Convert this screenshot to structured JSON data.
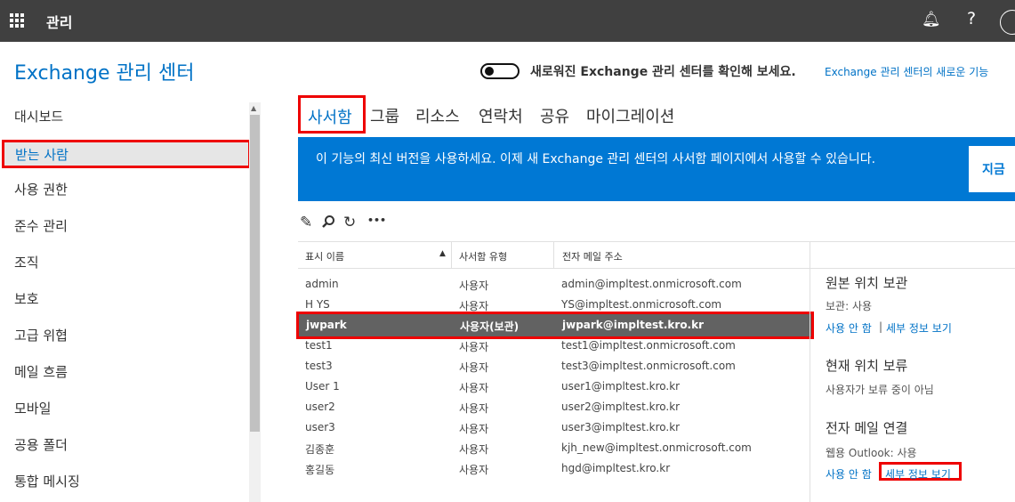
{
  "topbar": {
    "title": "관리"
  },
  "brand": "Exchange 관리 센터",
  "toggle": {
    "label": "새로워진 Exchange 관리 센터를 확인해 보세요.",
    "link": "Exchange 관리 센터의 새로운 기능"
  },
  "sidebar": {
    "items": [
      "대시보드",
      "받는 사람",
      "사용 권한",
      "준수 관리",
      "조직",
      "보호",
      "고급 위협",
      "메일 흐름",
      "모바일",
      "공용 폴더",
      "통합 메시징"
    ],
    "selected": 1
  },
  "tabs": [
    "사서함",
    "그룹",
    "리소스",
    "연락처",
    "공유",
    "마이그레이션"
  ],
  "banner": {
    "text": "이 기능의 최신 버전을 사용하세요. 이제 새 Exchange 관리 센터의 사서함 페이지에서 사용할 수 있습니다.",
    "button": "지금"
  },
  "toolbar": {
    "edit_icon": "pencil-icon",
    "search_icon": "search-icon",
    "refresh_icon": "refresh-icon",
    "more": "•••"
  },
  "table": {
    "columns": [
      "표시 이름",
      "사서함 유형",
      "전자 메일 주소"
    ],
    "rows": [
      {
        "name": "admin",
        "type": "사용자",
        "email": "admin@impltest.onmicrosoft.com"
      },
      {
        "name": "H YS",
        "type": "사용자",
        "email": "YS@impltest.onmicrosoft.com"
      },
      {
        "name": "jwpark",
        "type": "사용자(보관)",
        "email": "jwpark@impltest.kro.kr"
      },
      {
        "name": "test1",
        "type": "사용자",
        "email": "test1@impltest.onmicrosoft.com"
      },
      {
        "name": "test3",
        "type": "사용자",
        "email": "test3@impltest.onmicrosoft.com"
      },
      {
        "name": "User 1",
        "type": "사용자",
        "email": "user1@impltest.kro.kr"
      },
      {
        "name": "user2",
        "type": "사용자",
        "email": "user2@impltest.kro.kr"
      },
      {
        "name": "user3",
        "type": "사용자",
        "email": "user3@impltest.kro.kr"
      },
      {
        "name": "김종훈",
        "type": "사용자",
        "email": "kjh_new@impltest.onmicrosoft.com"
      },
      {
        "name": "홍길동",
        "type": "사용자",
        "email": "hgd@impltest.kro.kr"
      }
    ],
    "selected": 2
  },
  "details": {
    "archive": {
      "title": "원본 위치 보관",
      "status": "보관: 사용",
      "disable": "사용 안 함",
      "sep": "|",
      "view": "세부 정보 보기"
    },
    "hold": {
      "title": "현재 위치 보류",
      "status": "사용자가 보류 중이 아님"
    },
    "email": {
      "title": "전자 메일 연결",
      "status": "웹용 Outlook: 사용",
      "disable": "사용 안 함",
      "view": "세부 정보 보기"
    }
  }
}
